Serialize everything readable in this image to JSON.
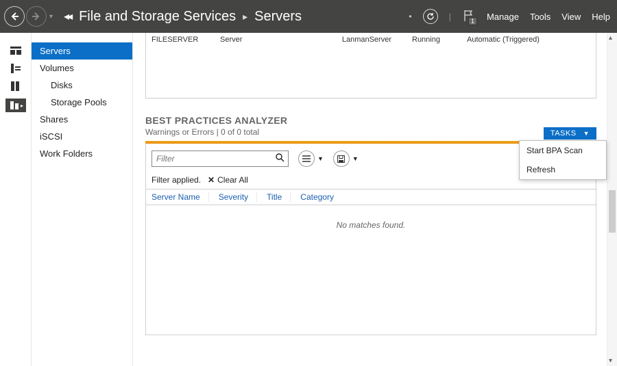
{
  "header": {
    "breadcrumb_back_glyph": "◂◂",
    "breadcrumb_root": "File and Storage Services",
    "breadcrumb_caret": "▸",
    "breadcrumb_current": "Servers",
    "flag_count": "1",
    "menus": {
      "manage": "Manage",
      "tools": "Tools",
      "view": "View",
      "help": "Help"
    }
  },
  "sidenav": {
    "servers": "Servers",
    "volumes": "Volumes",
    "disks": "Disks",
    "storage_pools": "Storage Pools",
    "shares": "Shares",
    "iscsi": "iSCSI",
    "work_folders": "Work Folders"
  },
  "servers_panel": {
    "row": {
      "name": "FILESERVER",
      "type": "Server",
      "service": "LanmanServer",
      "status": "Running",
      "start": "Automatic (Triggered)"
    }
  },
  "bpa": {
    "title": "BEST PRACTICES ANALYZER",
    "subtitle": "Warnings or Errors | 0 of 0 total",
    "tasks_label": "TASKS",
    "filter_placeholder": "Filter",
    "filter_applied": "Filter applied.",
    "clear_all": "Clear All",
    "columns": {
      "server": "Server Name",
      "severity": "Severity",
      "title": "Title",
      "category": "Category"
    },
    "no_match": "No matches found."
  },
  "tasks_menu": {
    "start_scan": "Start BPA Scan",
    "refresh": "Refresh"
  }
}
